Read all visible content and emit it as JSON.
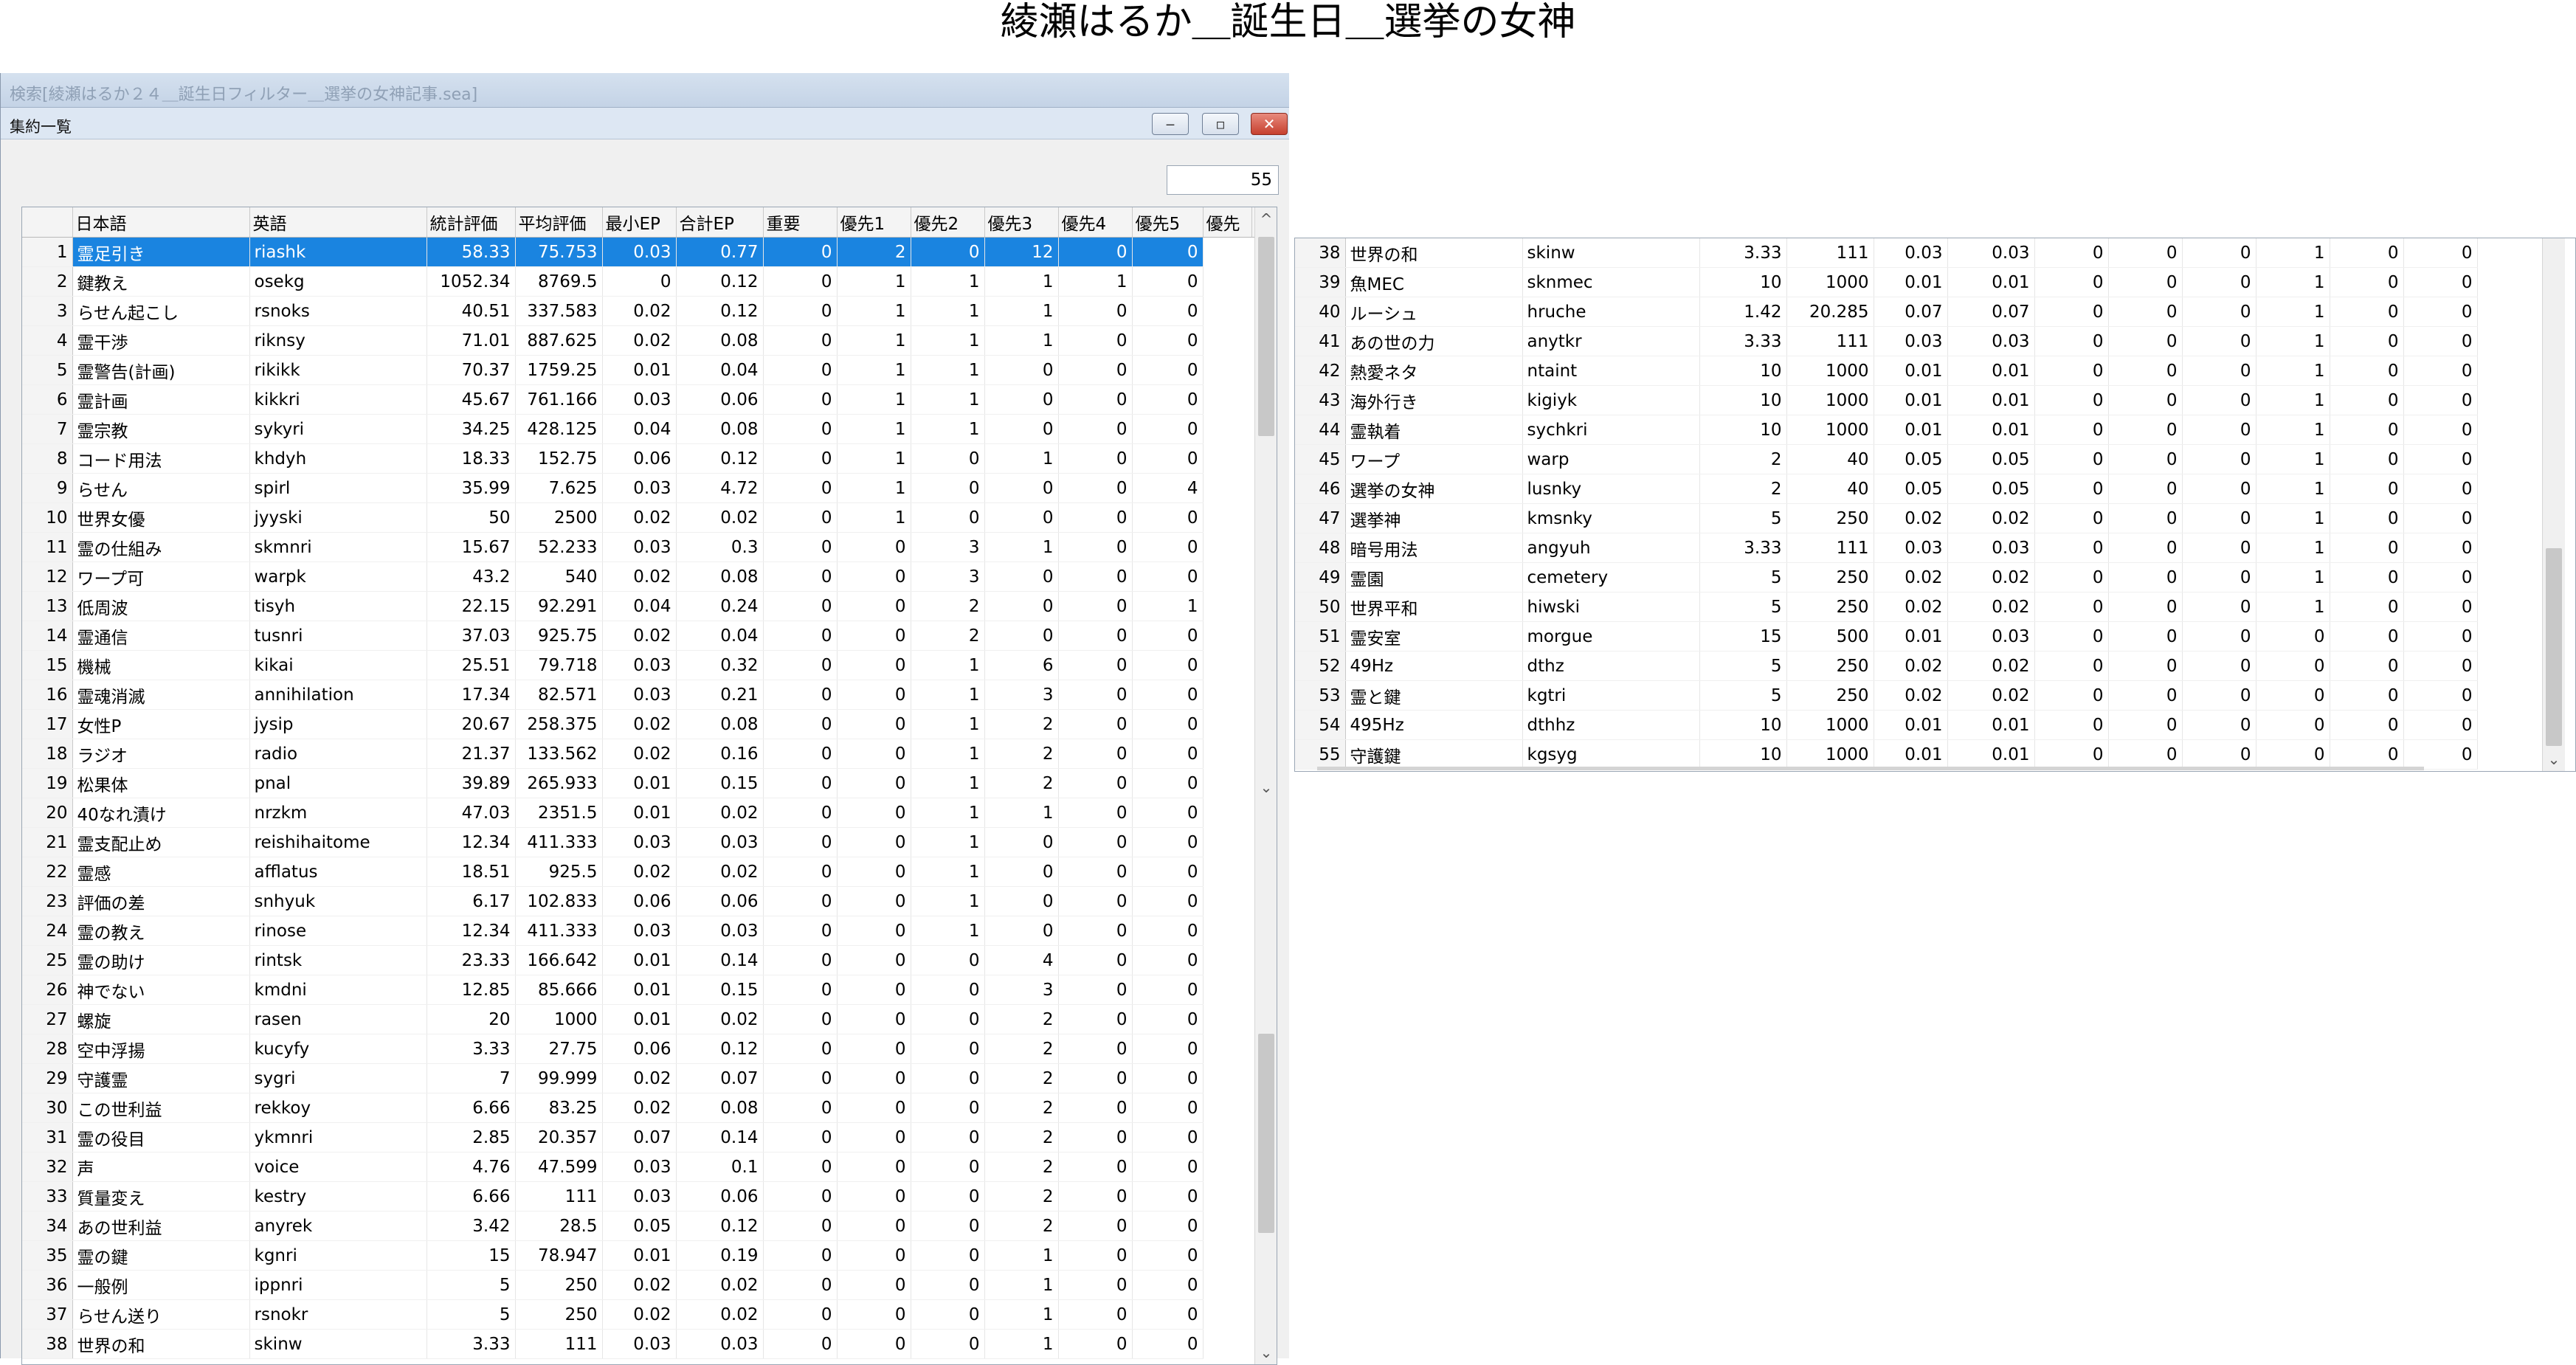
{
  "page": {
    "title": "綾瀬はるか＿誕生日＿選挙の女神"
  },
  "window": {
    "title": "検索[綾瀬はるか２４＿誕生日フィルター＿選挙の女神記事.sea]",
    "panel_title": "集約一覧",
    "buttons": {
      "minimize": "‒",
      "maximize": "▫",
      "close": "✕"
    },
    "count": "55"
  },
  "table": {
    "columns": [
      "日本語",
      "英語",
      "統計評価",
      "平均評価",
      "最小EP",
      "合計EP",
      "重要",
      "優先1",
      "優先2",
      "優先3",
      "優先4",
      "優先5",
      "優先"
    ],
    "selected_row": 1,
    "rows": [
      [
        "1",
        "霊足引き",
        "riashk",
        "58.33",
        "75.753",
        "0.03",
        "0.77",
        "0",
        "2",
        "0",
        "12",
        "0",
        "0"
      ],
      [
        "2",
        "鍵教え",
        "osekg",
        "1052.34",
        "8769.5",
        "0",
        "0.12",
        "0",
        "1",
        "1",
        "1",
        "1",
        "0"
      ],
      [
        "3",
        "らせん起こし",
        "rsnoks",
        "40.51",
        "337.583",
        "0.02",
        "0.12",
        "0",
        "1",
        "1",
        "1",
        "0",
        "0"
      ],
      [
        "4",
        "霊干渉",
        "riknsy",
        "71.01",
        "887.625",
        "0.02",
        "0.08",
        "0",
        "1",
        "1",
        "1",
        "0",
        "0"
      ],
      [
        "5",
        "霊警告(計画)",
        "rikikk",
        "70.37",
        "1759.25",
        "0.01",
        "0.04",
        "0",
        "1",
        "1",
        "0",
        "0",
        "0"
      ],
      [
        "6",
        "霊計画",
        "kikkri",
        "45.67",
        "761.166",
        "0.03",
        "0.06",
        "0",
        "1",
        "1",
        "0",
        "0",
        "0"
      ],
      [
        "7",
        "霊宗教",
        "sykyri",
        "34.25",
        "428.125",
        "0.04",
        "0.08",
        "0",
        "1",
        "1",
        "0",
        "0",
        "0"
      ],
      [
        "8",
        "コード用法",
        "khdyh",
        "18.33",
        "152.75",
        "0.06",
        "0.12",
        "0",
        "1",
        "0",
        "1",
        "0",
        "0"
      ],
      [
        "9",
        "らせん",
        "spirl",
        "35.99",
        "7.625",
        "0.03",
        "4.72",
        "0",
        "1",
        "0",
        "0",
        "0",
        "4"
      ],
      [
        "10",
        "世界女優",
        "jyyski",
        "50",
        "2500",
        "0.02",
        "0.02",
        "0",
        "1",
        "0",
        "0",
        "0",
        "0"
      ],
      [
        "11",
        "霊の仕組み",
        "skmnri",
        "15.67",
        "52.233",
        "0.03",
        "0.3",
        "0",
        "0",
        "3",
        "1",
        "0",
        "0"
      ],
      [
        "12",
        "ワープ可",
        "warpk",
        "43.2",
        "540",
        "0.02",
        "0.08",
        "0",
        "0",
        "3",
        "0",
        "0",
        "0"
      ],
      [
        "13",
        "低周波",
        "tisyh",
        "22.15",
        "92.291",
        "0.04",
        "0.24",
        "0",
        "0",
        "2",
        "0",
        "0",
        "1"
      ],
      [
        "14",
        "霊通信",
        "tusnri",
        "37.03",
        "925.75",
        "0.02",
        "0.04",
        "0",
        "0",
        "2",
        "0",
        "0",
        "0"
      ],
      [
        "15",
        "機械",
        "kikai",
        "25.51",
        "79.718",
        "0.03",
        "0.32",
        "0",
        "0",
        "1",
        "6",
        "0",
        "0"
      ],
      [
        "16",
        "霊魂消滅",
        "annihilation",
        "17.34",
        "82.571",
        "0.03",
        "0.21",
        "0",
        "0",
        "1",
        "3",
        "0",
        "0"
      ],
      [
        "17",
        "女性P",
        "jysip",
        "20.67",
        "258.375",
        "0.02",
        "0.08",
        "0",
        "0",
        "1",
        "2",
        "0",
        "0"
      ],
      [
        "18",
        "ラジオ",
        "radio",
        "21.37",
        "133.562",
        "0.02",
        "0.16",
        "0",
        "0",
        "1",
        "2",
        "0",
        "0"
      ],
      [
        "19",
        "松果体",
        "pnal",
        "39.89",
        "265.933",
        "0.01",
        "0.15",
        "0",
        "0",
        "1",
        "2",
        "0",
        "0"
      ],
      [
        "20",
        "40なれ漬け",
        "nrzkm",
        "47.03",
        "2351.5",
        "0.01",
        "0.02",
        "0",
        "0",
        "1",
        "1",
        "0",
        "0"
      ],
      [
        "21",
        "霊支配止め",
        "reishihaitome",
        "12.34",
        "411.333",
        "0.03",
        "0.03",
        "0",
        "0",
        "1",
        "0",
        "0",
        "0"
      ],
      [
        "22",
        "霊感",
        "afflatus",
        "18.51",
        "925.5",
        "0.02",
        "0.02",
        "0",
        "0",
        "1",
        "0",
        "0",
        "0"
      ],
      [
        "23",
        "評価の差",
        "snhyuk",
        "6.17",
        "102.833",
        "0.06",
        "0.06",
        "0",
        "0",
        "1",
        "0",
        "0",
        "0"
      ],
      [
        "24",
        "霊の教え",
        "rinose",
        "12.34",
        "411.333",
        "0.03",
        "0.03",
        "0",
        "0",
        "1",
        "0",
        "0",
        "0"
      ],
      [
        "25",
        "霊の助け",
        "rintsk",
        "23.33",
        "166.642",
        "0.01",
        "0.14",
        "0",
        "0",
        "0",
        "4",
        "0",
        "0"
      ],
      [
        "26",
        "神でない",
        "kmdni",
        "12.85",
        "85.666",
        "0.01",
        "0.15",
        "0",
        "0",
        "0",
        "3",
        "0",
        "0"
      ],
      [
        "27",
        "螺旋",
        "rasen",
        "20",
        "1000",
        "0.01",
        "0.02",
        "0",
        "0",
        "0",
        "2",
        "0",
        "0"
      ],
      [
        "28",
        "空中浮揚",
        "kucyfy",
        "3.33",
        "27.75",
        "0.06",
        "0.12",
        "0",
        "0",
        "0",
        "2",
        "0",
        "0"
      ],
      [
        "29",
        "守護霊",
        "sygri",
        "7",
        "99.999",
        "0.02",
        "0.07",
        "0",
        "0",
        "0",
        "2",
        "0",
        "0"
      ],
      [
        "30",
        "この世利益",
        "rekkoy",
        "6.66",
        "83.25",
        "0.02",
        "0.08",
        "0",
        "0",
        "0",
        "2",
        "0",
        "0"
      ],
      [
        "31",
        "霊の役目",
        "ykmnri",
        "2.85",
        "20.357",
        "0.07",
        "0.14",
        "0",
        "0",
        "0",
        "2",
        "0",
        "0"
      ],
      [
        "32",
        "声",
        "voice",
        "4.76",
        "47.599",
        "0.03",
        "0.1",
        "0",
        "0",
        "0",
        "2",
        "0",
        "0"
      ],
      [
        "33",
        "質量変え",
        "kestry",
        "6.66",
        "111",
        "0.03",
        "0.06",
        "0",
        "0",
        "0",
        "2",
        "0",
        "0"
      ],
      [
        "34",
        "あの世利益",
        "anyrek",
        "3.42",
        "28.5",
        "0.05",
        "0.12",
        "0",
        "0",
        "0",
        "2",
        "0",
        "0"
      ],
      [
        "35",
        "霊の鍵",
        "kgnri",
        "15",
        "78.947",
        "0.01",
        "0.19",
        "0",
        "0",
        "0",
        "1",
        "0",
        "0"
      ],
      [
        "36",
        "一般例",
        "ippnri",
        "5",
        "250",
        "0.02",
        "0.02",
        "0",
        "0",
        "0",
        "1",
        "0",
        "0"
      ],
      [
        "37",
        "らせん送り",
        "rsnokr",
        "5",
        "250",
        "0.02",
        "0.02",
        "0",
        "0",
        "0",
        "1",
        "0",
        "0"
      ],
      [
        "38",
        "世界の和",
        "skinw",
        "3.33",
        "111",
        "0.03",
        "0.03",
        "0",
        "0",
        "0",
        "1",
        "0",
        "0"
      ]
    ]
  },
  "table_right": {
    "rows": [
      [
        "38",
        "世界の和",
        "skinw",
        "3.33",
        "111",
        "0.03",
        "0.03",
        "0",
        "0",
        "0",
        "1",
        "0",
        "0"
      ],
      [
        "39",
        "魚MEC",
        "sknmec",
        "10",
        "1000",
        "0.01",
        "0.01",
        "0",
        "0",
        "0",
        "1",
        "0",
        "0"
      ],
      [
        "40",
        "ルーシュ",
        "hruche",
        "1.42",
        "20.285",
        "0.07",
        "0.07",
        "0",
        "0",
        "0",
        "1",
        "0",
        "0"
      ],
      [
        "41",
        "あの世の力",
        "anytkr",
        "3.33",
        "111",
        "0.03",
        "0.03",
        "0",
        "0",
        "0",
        "1",
        "0",
        "0"
      ],
      [
        "42",
        "熱愛ネタ",
        "ntaint",
        "10",
        "1000",
        "0.01",
        "0.01",
        "0",
        "0",
        "0",
        "1",
        "0",
        "0"
      ],
      [
        "43",
        "海外行き",
        "kigiyk",
        "10",
        "1000",
        "0.01",
        "0.01",
        "0",
        "0",
        "0",
        "1",
        "0",
        "0"
      ],
      [
        "44",
        "霊執着",
        "sychkri",
        "10",
        "1000",
        "0.01",
        "0.01",
        "0",
        "0",
        "0",
        "1",
        "0",
        "0"
      ],
      [
        "45",
        "ワープ",
        "warp",
        "2",
        "40",
        "0.05",
        "0.05",
        "0",
        "0",
        "0",
        "1",
        "0",
        "0"
      ],
      [
        "46",
        "選挙の女神",
        "lusnky",
        "2",
        "40",
        "0.05",
        "0.05",
        "0",
        "0",
        "0",
        "1",
        "0",
        "0"
      ],
      [
        "47",
        "選挙神",
        "kmsnky",
        "5",
        "250",
        "0.02",
        "0.02",
        "0",
        "0",
        "0",
        "1",
        "0",
        "0"
      ],
      [
        "48",
        "暗号用法",
        "angyuh",
        "3.33",
        "111",
        "0.03",
        "0.03",
        "0",
        "0",
        "0",
        "1",
        "0",
        "0"
      ],
      [
        "49",
        "霊園",
        "cemetery",
        "5",
        "250",
        "0.02",
        "0.02",
        "0",
        "0",
        "0",
        "1",
        "0",
        "0"
      ],
      [
        "50",
        "世界平和",
        "hiwski",
        "5",
        "250",
        "0.02",
        "0.02",
        "0",
        "0",
        "0",
        "1",
        "0",
        "0"
      ],
      [
        "51",
        "霊安室",
        "morgue",
        "15",
        "500",
        "0.01",
        "0.03",
        "0",
        "0",
        "0",
        "0",
        "0",
        "0"
      ],
      [
        "52",
        "49Hz",
        "dthz",
        "5",
        "250",
        "0.02",
        "0.02",
        "0",
        "0",
        "0",
        "0",
        "0",
        "0"
      ],
      [
        "53",
        "霊と鍵",
        "kgtri",
        "5",
        "250",
        "0.02",
        "0.02",
        "0",
        "0",
        "0",
        "0",
        "0",
        "0"
      ],
      [
        "54",
        "495Hz",
        "dthhz",
        "10",
        "1000",
        "0.01",
        "0.01",
        "0",
        "0",
        "0",
        "0",
        "0",
        "0"
      ],
      [
        "55",
        "守護鍵",
        "kgsyg",
        "10",
        "1000",
        "0.01",
        "0.01",
        "0",
        "0",
        "0",
        "0",
        "0",
        "0"
      ]
    ]
  },
  "scroll": {
    "up": "^",
    "down": "⌄"
  },
  "icons": {
    "minimize": "minimize-icon",
    "maximize": "maximize-icon",
    "close": "close-icon"
  }
}
